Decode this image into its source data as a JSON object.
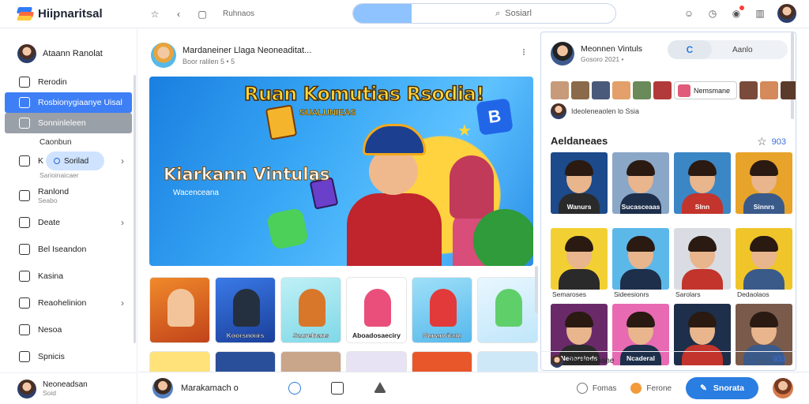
{
  "app": {
    "title": "Hiipnaritsal"
  },
  "topbar": {
    "link": "Ruhnaos",
    "search_placeholder": "Sosiarl"
  },
  "sidebar": {
    "user_name": "Ataann Ranolat",
    "items": [
      {
        "label": "Rerodin"
      },
      {
        "label": "Rosbionygiaanye Uisal"
      },
      {
        "label": "Sonninleleen"
      },
      {
        "label": "Caonbun"
      },
      {
        "label": "K",
        "pill": "Sorilad",
        "sub": "Sarioinaicaer"
      },
      {
        "label": "Ranlond",
        "sub": "Seabo"
      },
      {
        "label": "Deate"
      },
      {
        "label": "Bel Iseandon"
      },
      {
        "label": "Kasina"
      },
      {
        "label": "Reaohelinion"
      },
      {
        "label": "Nesoa"
      },
      {
        "label": "Spnicis"
      }
    ],
    "footer": {
      "name": "Neoneadsan",
      "sub": "Soid"
    }
  },
  "post": {
    "author": "Mardaneiner Llaga Neoneaditat...",
    "meta": "Boor ralilen 5 • 5",
    "hero": {
      "title": "Ruan Komutias Rsodia!",
      "subtitle": "SUALUNIEAS",
      "left_title": "Kiarkann Vintulas",
      "left_sub": "Wacenceana",
      "badge": "B"
    },
    "tiles": [
      {
        "caption": ""
      },
      {
        "caption": "Koorsnoiirs"
      },
      {
        "caption": "Saurelnans"
      },
      {
        "caption": "Aboadosaeciry"
      },
      {
        "caption": "Nunanvitatu"
      },
      {
        "caption": ""
      }
    ]
  },
  "right_panel": {
    "author": "Meonnen Vintuls",
    "meta": "Gosoro 2021 •",
    "toggle_label": "Aanlo",
    "chip": "Nemsmane",
    "caption": "Ideoleneaolen lo Ssia",
    "section_title": "Aeldaneaes",
    "section_count": "903",
    "cards": [
      {
        "label": "Wanurs",
        "below": "",
        "bg": "#1c4a8a"
      },
      {
        "label": "Sucasceaas",
        "below": "",
        "bg": "#8aa7c8"
      },
      {
        "label": "Slnn",
        "below": "",
        "bg": "#3b86c5"
      },
      {
        "label": "Sinnrs",
        "below": "",
        "bg": "#e8a32a"
      },
      {
        "label": "",
        "below": "Semaroses",
        "bg": "#f2d033"
      },
      {
        "label": "",
        "below": "Sideesionrs",
        "bg": "#5db8ea"
      },
      {
        "label": "",
        "below": "Sarolars",
        "bg": "#d9dde3"
      },
      {
        "label": "",
        "below": "Dedaolaos",
        "bg": "#f0c52a"
      },
      {
        "label": "Nenorsiods",
        "below": "",
        "bg": "#6a2a6a"
      },
      {
        "label": "Ncaderal",
        "below": "",
        "bg": "#e86ab2"
      },
      {
        "label": "",
        "below": "",
        "bg": "#1d2f4a"
      },
      {
        "label": "",
        "below": "",
        "bg": "#7a5a4a"
      }
    ],
    "footer": {
      "name": "Bledniemane",
      "count": "933"
    }
  },
  "bottombar": {
    "user_name": "Marakamach ᴏ",
    "item1": "Fomas",
    "item2": "Ferone",
    "primary": "Snorata"
  }
}
